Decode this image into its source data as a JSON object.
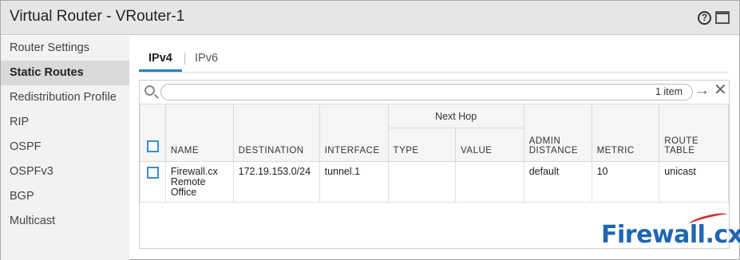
{
  "window": {
    "title": "Virtual Router - VRouter-1"
  },
  "sidebar": {
    "items": [
      {
        "label": "Router Settings"
      },
      {
        "label": "Static Routes",
        "active": true
      },
      {
        "label": "Redistribution Profile"
      },
      {
        "label": "RIP"
      },
      {
        "label": "OSPF"
      },
      {
        "label": "OSPFv3"
      },
      {
        "label": "BGP"
      },
      {
        "label": "Multicast"
      }
    ]
  },
  "tabs": [
    {
      "label": "IPv4",
      "active": true
    },
    {
      "label": "IPv6"
    }
  ],
  "search": {
    "value": "",
    "item_count": "1 item"
  },
  "table": {
    "group_header": "Next Hop",
    "columns": {
      "name": "NAME",
      "destination": "DESTINATION",
      "interface": "INTERFACE",
      "type": "TYPE",
      "value": "VALUE",
      "admin_distance_line1": "ADMIN",
      "admin_distance_line2": "DISTANCE",
      "metric": "METRIC",
      "route_table_line1": "ROUTE",
      "route_table_line2": "TABLE"
    },
    "rows": [
      {
        "name_line1": "Firewall.cx",
        "name_line2": "Remote",
        "name_line3": "Office",
        "destination": "172.19.153.0/24",
        "interface": "tunnel.1",
        "type": "",
        "value": "",
        "admin_distance": "default",
        "metric": "10",
        "route_table": "unicast"
      }
    ]
  },
  "watermark": {
    "text": "Firewall.cx"
  },
  "colors": {
    "accent": "#2e7fb8",
    "checkbox": "#3b8ec7",
    "watermark": "#1f66b3",
    "watermark_swoosh": "#d8332a"
  }
}
